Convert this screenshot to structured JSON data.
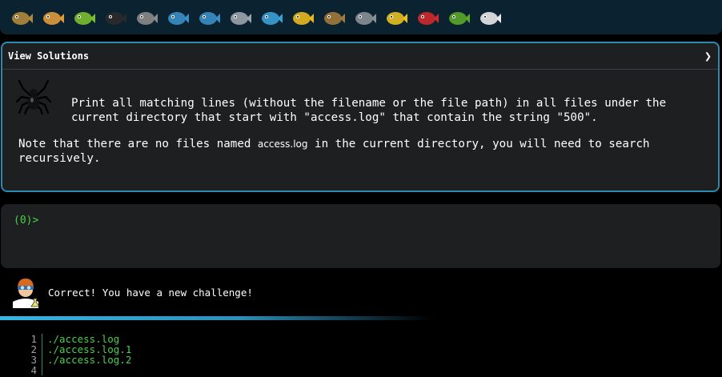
{
  "levels": [
    {
      "name": "snail-icon",
      "color": "#b08a3c"
    },
    {
      "name": "butterfly-icon",
      "color": "#e09a3c"
    },
    {
      "name": "caterpillar-icon",
      "color": "#7bbf2d"
    },
    {
      "name": "ant-icon",
      "color": "#2a2a2a"
    },
    {
      "name": "spiderweb-icon",
      "color": "#8a8a8a"
    },
    {
      "name": "whale-icon",
      "color": "#3a8fc8"
    },
    {
      "name": "dolphin-icon",
      "color": "#3a8fc8"
    },
    {
      "name": "shark-icon",
      "color": "#9aa4ad"
    },
    {
      "name": "fish-icon",
      "color": "#3aa0d8"
    },
    {
      "name": "tropical-fish-icon",
      "color": "#e8b820"
    },
    {
      "name": "pufferfish-icon",
      "color": "#a07a3a"
    },
    {
      "name": "wolf-icon",
      "color": "#8a8f96"
    },
    {
      "name": "bee-icon",
      "color": "#e8c020"
    },
    {
      "name": "ladybug-icon",
      "color": "#d02a2a"
    },
    {
      "name": "lizard-icon",
      "color": "#5aa82a"
    },
    {
      "name": "spider-icon",
      "color": "#e8e8e8"
    }
  ],
  "panel": {
    "title": "View Solutions",
    "chevron": "❯",
    "description": "Print all matching lines (without the filename or the file path) in all files under the\ncurrent directory that start with \"access.log\" that contain the string \"500\".",
    "note_pre": "Note that there are no files named ",
    "note_code": "access.log",
    "note_post": " in the current directory, you will need to search\nrecursively."
  },
  "terminal": {
    "prompt": "(0)>"
  },
  "result": {
    "message": "Correct! You have a new challenge!"
  },
  "output": [
    {
      "n": "1",
      "text": "./access.log"
    },
    {
      "n": "2",
      "text": "./access.log.1"
    },
    {
      "n": "3",
      "text": "./access.log.2"
    },
    {
      "n": "4",
      "text": ""
    }
  ]
}
